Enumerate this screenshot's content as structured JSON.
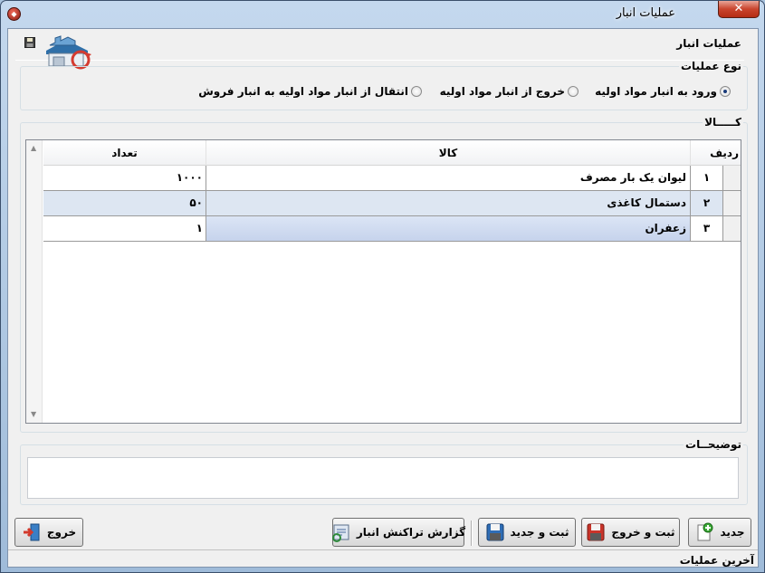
{
  "window": {
    "title": "عملیات انبار",
    "close_glyph": "✕"
  },
  "header": {
    "title": "عملیات انبار"
  },
  "operation_type": {
    "legend": "نوع عملیات",
    "options": [
      {
        "label": "ورود به انبار مواد اولیه",
        "selected": true
      },
      {
        "label": "خروج از انبار مواد اولیه",
        "selected": false
      },
      {
        "label": "انتقال از انبار مواد اولیه به انبار فروش",
        "selected": false
      }
    ]
  },
  "goods": {
    "legend": "کـــــالا",
    "columns": {
      "row": "ردیف",
      "item": "کالا",
      "qty": "تعداد"
    },
    "rows": [
      {
        "num": "۱",
        "item": "لیوان یک بار مصرف",
        "qty": "۱۰۰۰"
      },
      {
        "num": "۲",
        "item": "دستمال کاغذی",
        "qty": "۵۰"
      },
      {
        "num": "۳",
        "item": "زعفران",
        "qty": "۱"
      }
    ],
    "scroll_up": "▲",
    "scroll_down": "▼"
  },
  "description": {
    "legend": "توضیحــات",
    "value": ""
  },
  "buttons": {
    "new": "جدید",
    "save_exit": "ثبت و خروج",
    "save_new": "ثبت و جدید",
    "report": "گزارش تراکنش انبار",
    "exit": "خروج"
  },
  "status_bar": {
    "text": "آخرین عملیات"
  },
  "colors": {
    "selected_row": "#dde6f2",
    "active_cell": "#c6d3ec"
  },
  "icons": [
    "floppy-icon",
    "warehouse-icon",
    "new-doc-icon",
    "save-red-icon",
    "save-blue-icon",
    "report-icon",
    "exit-icon"
  ]
}
